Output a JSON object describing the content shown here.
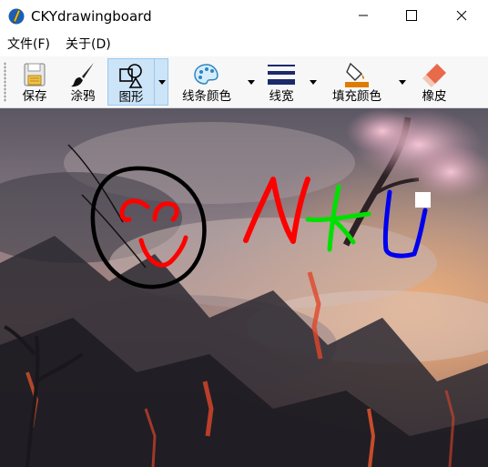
{
  "window": {
    "title": "CKYdrawingboard",
    "icon": "pencil-icon",
    "controls": [
      "minimize-icon",
      "maximize-icon",
      "close-icon"
    ]
  },
  "menu": {
    "items": [
      {
        "label": "文件(F)"
      },
      {
        "label": "关于(D)"
      }
    ]
  },
  "toolbar": {
    "items": [
      {
        "label": "保存",
        "icon": "save-icon"
      },
      {
        "label": "涂鸦",
        "icon": "brush-icon"
      },
      {
        "label": "图形",
        "icon": "shapes-icon",
        "selected": true
      },
      {
        "label": "线条颜色",
        "icon": "palette-icon"
      },
      {
        "label": "线宽",
        "icon": "line-width-icon"
      },
      {
        "label": "填充颜色",
        "icon": "fill-bucket-icon"
      },
      {
        "label": "橡皮",
        "icon": "eraser-icon"
      }
    ]
  },
  "canvas": {
    "background": "sunset landscape with cherry blossom tree",
    "drawings": [
      {
        "name": "black-circle",
        "color": "#000000"
      },
      {
        "name": "red-smiley-face",
        "color": "#ff0000"
      },
      {
        "name": "red-letter-N",
        "color": "#ff0000"
      },
      {
        "name": "green-letter-K",
        "color": "#00e000"
      },
      {
        "name": "blue-letter-U",
        "color": "#0000ee"
      },
      {
        "name": "white-square",
        "color": "#ffffff"
      }
    ]
  },
  "colors": {
    "selection_bg": "#cce4f7",
    "selection_border": "#99c9ef",
    "toolbar_bg": "#f7f7f7"
  }
}
